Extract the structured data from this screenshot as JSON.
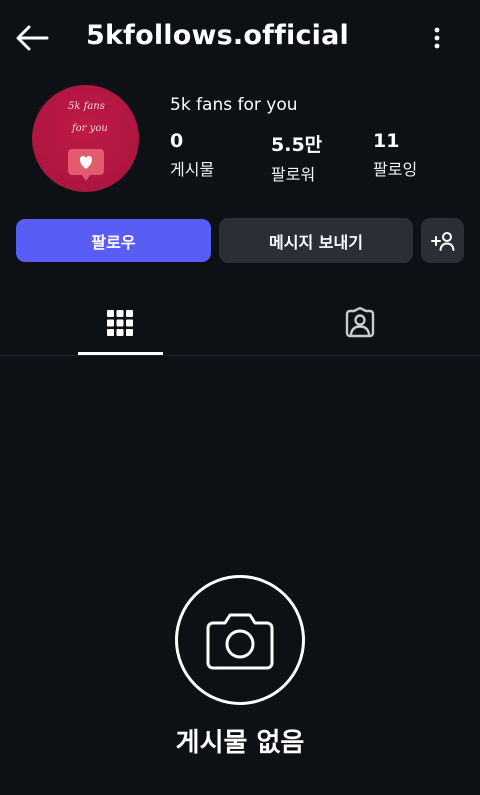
{
  "header": {
    "back_icon": "arrow-left-icon",
    "title": "5kfollows.official",
    "more_icon": "more-vertical-icon"
  },
  "profile": {
    "avatar_line1": "5k fans",
    "avatar_line2": "for you",
    "avatar_icon": "heart-chat-icon",
    "bio": "5k fans for you",
    "stats": [
      {
        "value": "0",
        "label": "게시물"
      },
      {
        "value": "5.5만",
        "label": "팔로워"
      },
      {
        "value": "11",
        "label": "팔로잉"
      }
    ]
  },
  "actions": {
    "follow_label": "팔로우",
    "message_label": "메시지 보내기",
    "add_user_icon": "person-add-icon"
  },
  "tabs": [
    {
      "icon": "grid-icon",
      "active": true
    },
    {
      "icon": "tagged-person-icon",
      "active": false
    }
  ],
  "empty_state": {
    "icon": "camera-icon",
    "text": "게시물 없음"
  },
  "colors": {
    "background": "#0d1014",
    "accent": "#5a5cf6",
    "secondary_button": "#2a2e35",
    "avatar": "#ad1640"
  }
}
